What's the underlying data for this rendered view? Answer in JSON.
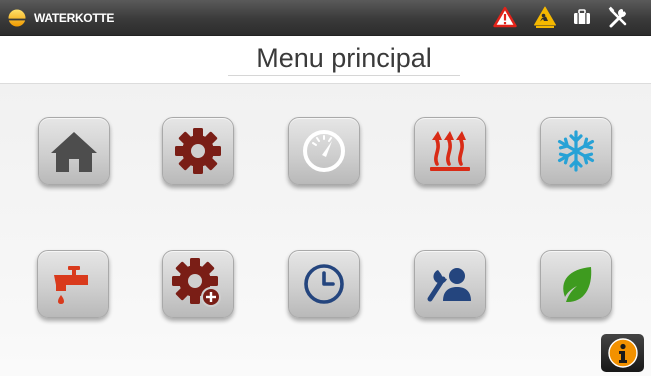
{
  "header": {
    "brand": "WATERKOTTE",
    "title": "Menu principal",
    "status_icons": [
      "warning-icon",
      "service-alert-icon",
      "briefcase-icon",
      "tools-icon"
    ]
  },
  "menu": {
    "row1": [
      "home-icon",
      "gear-icon",
      "gauge-icon",
      "heating-icon",
      "snowflake-icon"
    ],
    "row2": [
      "hot-water-tap-icon",
      "gear-add-icon",
      "clock-icon",
      "user-tools-icon",
      "leaf-icon"
    ]
  },
  "colors": {
    "gear": "#7a1e16",
    "heating": "#d92b16",
    "snowflake": "#27a2d6",
    "tap": "#d93a1c",
    "navy": "#24457e",
    "leaf": "#3e9b1f",
    "info": "#f29100"
  }
}
